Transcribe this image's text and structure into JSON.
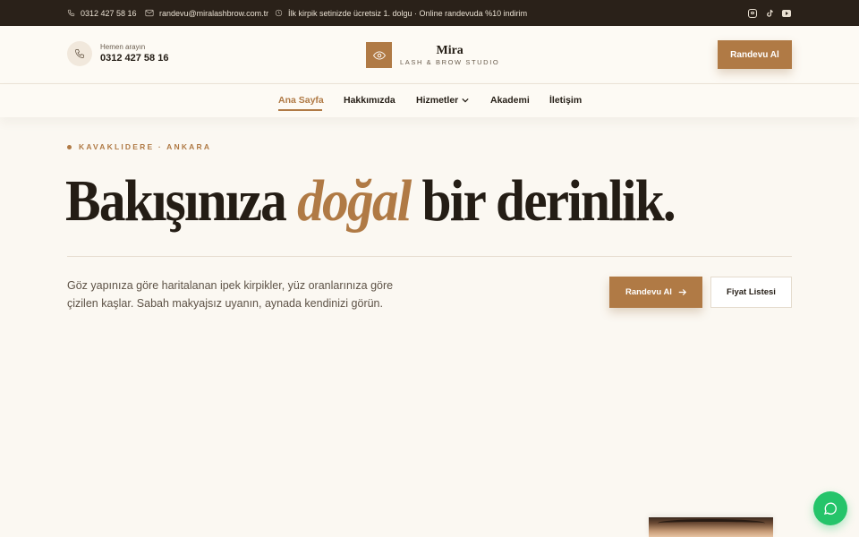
{
  "topbar": {
    "phone": "0312 427 58 16",
    "email": "randevu@miralashbrow.com.tr",
    "promo": "İlk kirpik setinizde ücretsiz 1. dolgu · Online randevuda %10 indirim",
    "social": [
      {
        "icon": "instagram-icon"
      },
      {
        "icon": "tiktok-icon"
      },
      {
        "icon": "youtube-icon"
      }
    ]
  },
  "header": {
    "call_label": "Hemen arayın",
    "call_phone": "0312 427 58 16",
    "logo_name": "Mira",
    "logo_sub": "LASH & BROW STUDIO",
    "cta": "Randevu Al"
  },
  "nav": {
    "items": [
      {
        "label": "Ana Sayfa",
        "active": true
      },
      {
        "label": "Hakkımızda"
      },
      {
        "label": "Hizmetler",
        "has_dropdown": true
      },
      {
        "label": "Akademi"
      },
      {
        "label": "İletişim"
      }
    ]
  },
  "hero": {
    "eyebrow": "KAVAKLIDERE · ANKARA",
    "headline_pre": "Bakışınıza ",
    "headline_accent": "doğal",
    "headline_post": " bir derinlik.",
    "description": "Göz yapınıza göre haritalanan ipek kirpikler, yüz oranlarınıza göre çizilen kaşlar. Sabah makyajsız uyanın, aynada kendinizi görün.",
    "primary_button": "Randevu Al",
    "secondary_button": "Fiyat Listesi"
  },
  "colors": {
    "accent": "#b07a45",
    "topbar_bg": "#2a2119",
    "page_bg": "#fbf8f2",
    "whatsapp": "#25c46a"
  }
}
